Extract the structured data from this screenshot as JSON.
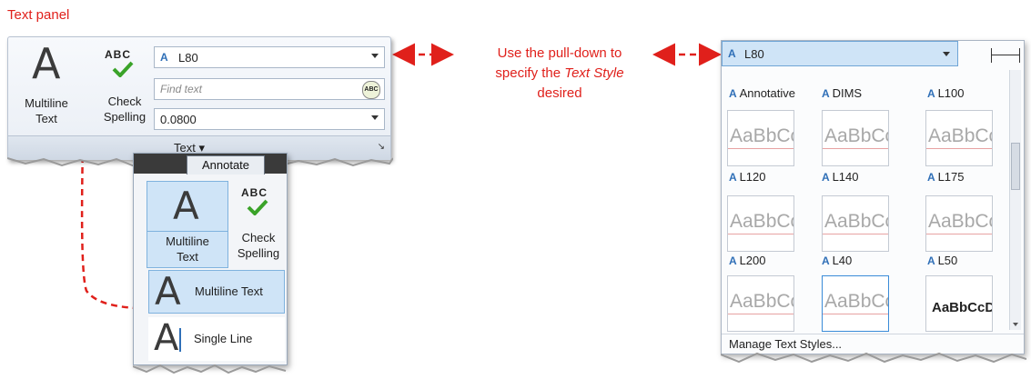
{
  "captions": {
    "text_panel": "Text panel",
    "callout_line1": "Use the pull-down to",
    "callout_line2_prefix": "specify the ",
    "callout_line2_italic": "Text Style",
    "callout_line3": "desired"
  },
  "ribbon": {
    "multiline_label_1": "Multiline",
    "multiline_label_2": "Text",
    "check_label_1": "Check",
    "check_label_2": "Spelling",
    "abc": "ABC",
    "style_value": "L80",
    "find_placeholder": "Find text",
    "height_value": "0.0800",
    "panel_title": "Text ▾",
    "launcher": "↘"
  },
  "annotate": {
    "tab_label": "Annotate",
    "multiline_label_1": "Multiline",
    "multiline_label_2": "Text",
    "check_label_1": "Check",
    "check_label_2": "Spelling",
    "abc": "ABC",
    "menu_multiline": "Multiline Text",
    "menu_single": "Single Line"
  },
  "gallery": {
    "combo_value": "L80",
    "header_items": [
      "Annotative",
      "DIMS",
      "L100"
    ],
    "row1_labels": [
      "L120",
      "L140",
      "L175"
    ],
    "row2_labels": [
      "L200",
      "L40",
      "L50"
    ],
    "sample_text": "AaBbCc",
    "bold_sample": "AaBbCcD",
    "manage": "Manage Text Styles..."
  },
  "colors": {
    "annotation_red": "#e0201b",
    "check_green": "#3aa329",
    "style_icon_blue": "#2f6fb7",
    "selection_blue": "#cfe4f7"
  }
}
